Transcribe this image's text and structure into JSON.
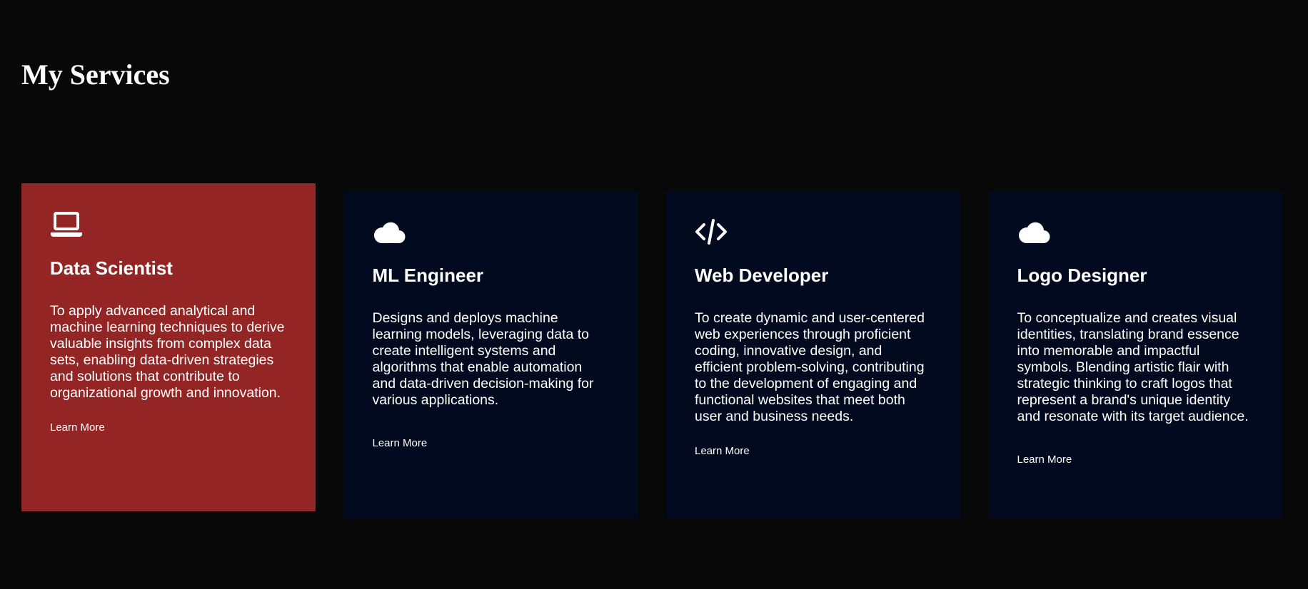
{
  "page": {
    "title": "My Services"
  },
  "colors": {
    "background": "#080808",
    "card_default": "#020a1f",
    "card_active": "#932524",
    "text": "#ffffff"
  },
  "services": [
    {
      "icon": "laptop-icon",
      "title": "Data Scientist",
      "description": "To apply advanced analytical and machine learning techniques to derive valuable insights from complex data sets, enabling data-driven strategies and solutions that contribute to organizational growth and innovation.",
      "link_label": "Learn More",
      "active": true
    },
    {
      "icon": "cloud-icon",
      "title": "ML Engineer",
      "description": "Designs and deploys machine learning models, leveraging data to create intelligent systems and algorithms that enable automation and data-driven decision-making for various applications.",
      "link_label": "Learn More",
      "active": false
    },
    {
      "icon": "code-icon",
      "title": "Web Developer",
      "description": "To create dynamic and user-centered web experiences through proficient coding, innovative design, and efficient problem-solving, contributing to the development of engaging and functional websites that meet both user and business needs.",
      "link_label": "Learn More",
      "active": false
    },
    {
      "icon": "cloud-icon",
      "title": "Logo Designer",
      "description": "To conceptualize and creates visual identities, translating brand essence into memorable and impactful symbols. Blending artistic flair with strategic thinking to craft logos that represent a brand's unique identity and resonate with its target audience.",
      "link_label": "Learn More",
      "active": false
    }
  ]
}
